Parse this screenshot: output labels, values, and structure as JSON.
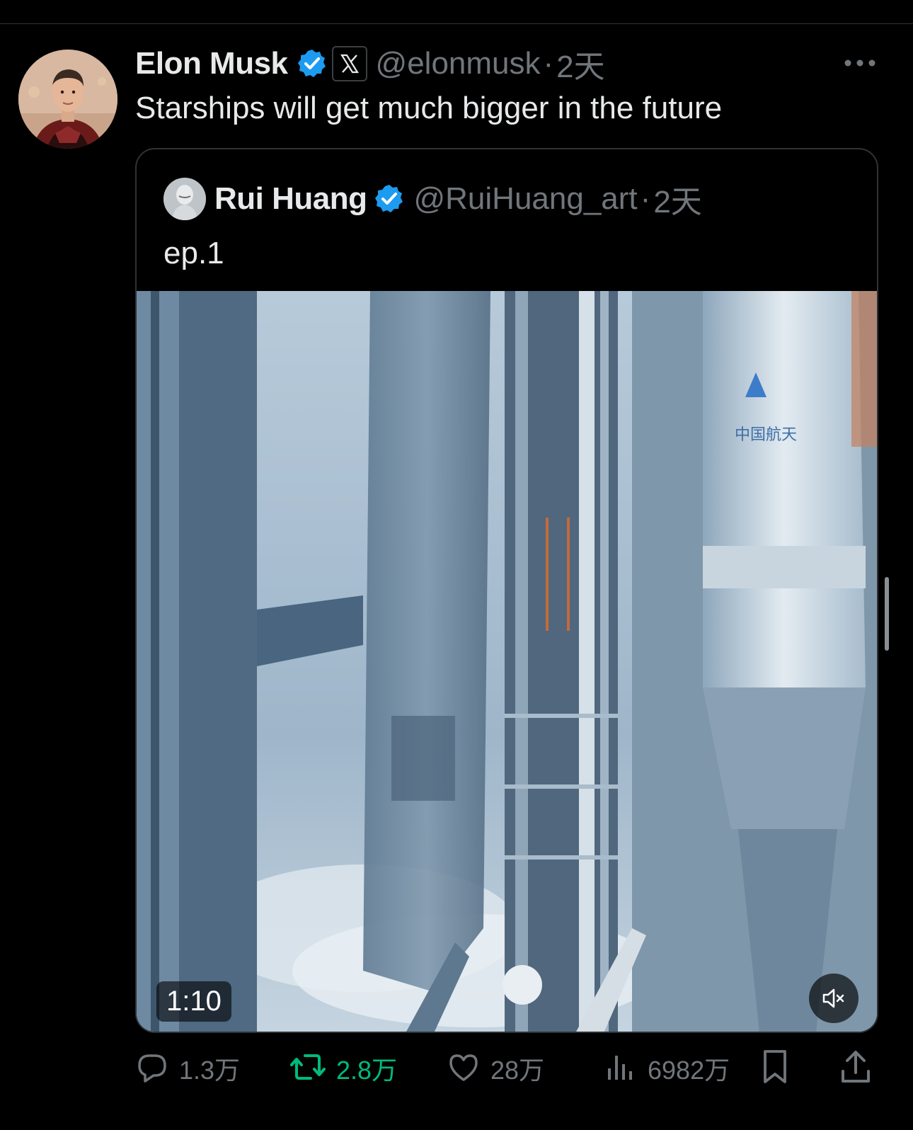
{
  "tweet": {
    "author_name": "Elon Musk",
    "handle": "@elonmusk",
    "separator": "·",
    "time": "2天",
    "text": "Starships will get much bigger in the future"
  },
  "quote": {
    "author_name": "Rui Huang",
    "handle": "@RuiHuang_art",
    "separator": "·",
    "time": "2天",
    "text": "ep.1"
  },
  "video": {
    "duration": "1:10",
    "overlay_text": "中国航天"
  },
  "actions": {
    "replies": "1.3万",
    "reposts": "2.8万",
    "likes": "28万",
    "views": "6982万"
  },
  "colors": {
    "background": "#000000",
    "text_primary": "#e7e9ea",
    "text_secondary": "#71767b",
    "verified_blue": "#1d9bf0",
    "repost_green": "#00ba7c",
    "border": "#2f3336"
  },
  "icons": [
    "verified-badge-icon",
    "x-logo-icon",
    "more-icon",
    "reply-icon",
    "repost-icon",
    "like-icon",
    "views-icon",
    "bookmark-icon",
    "share-icon",
    "mute-icon"
  ]
}
